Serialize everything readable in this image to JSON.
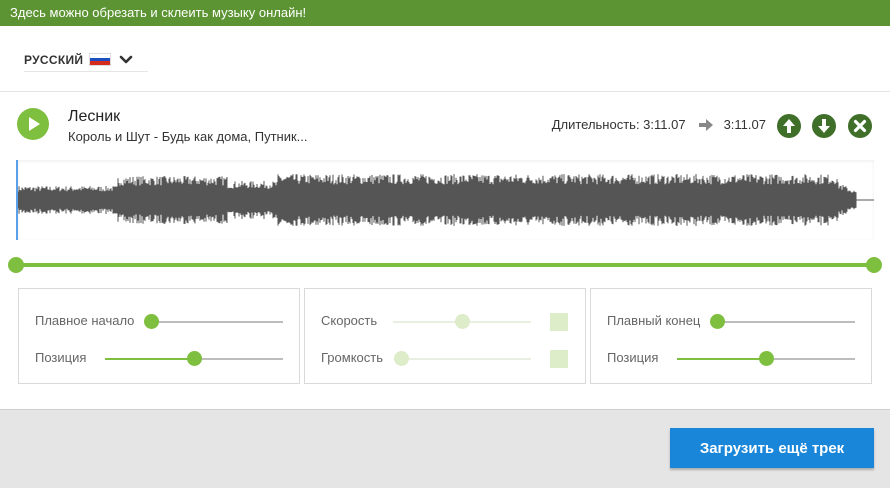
{
  "banner": {
    "text": "Здесь можно обрезать и склеить музыку онлайн!"
  },
  "language": {
    "label": "РУССКИЙ",
    "flag_icon": "russia-flag-icon",
    "flag_colors": [
      "#ffffff",
      "#1d4fbf",
      "#d52b1e"
    ]
  },
  "track": {
    "title": "Лесник",
    "artist": "Король и Шут - Будь как дома, Путник...",
    "duration_label": "Длительность: 3:11.07",
    "result_duration": "3:11.07"
  },
  "selection": {
    "start": 0.0,
    "end": 1.0
  },
  "panels": {
    "fade_in": {
      "label": "Плавное начало",
      "value": 0.0,
      "position_label": "Позиция",
      "position": 0.5
    },
    "speed_volume": {
      "speed_label": "Скорость",
      "speed": 0.5,
      "volume_label": "Громкость",
      "volume": 0.0
    },
    "fade_out": {
      "label": "Плавный конец",
      "value": 0.0,
      "position_label": "Позиция",
      "position": 0.5
    }
  },
  "footer": {
    "upload_label": "Загрузить ещё трек"
  },
  "colors": {
    "accent_green": "#7fbf3f",
    "banner_green": "#5d9433",
    "dark_green": "#3f6f29",
    "upload_blue": "#1a86d9",
    "waveform": "#555555"
  }
}
